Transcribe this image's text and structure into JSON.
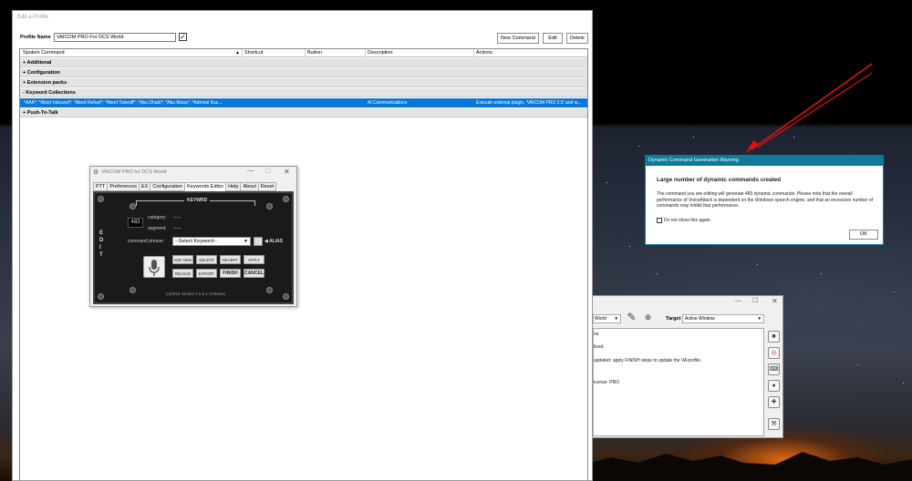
{
  "main_window": {
    "title": "Edit a Profile",
    "profile_label": "Profile Name",
    "profile_name": "VAICOM PRO For DCS World",
    "buttons": {
      "new_command": "New Command",
      "edit": "Edit",
      "delete": "Delete"
    },
    "columns": [
      "Spoken Command",
      "Shortcut",
      "Button",
      "Description",
      "Actions"
    ],
    "groups": [
      "+ Additional",
      "+ Configuration",
      "+ Extension packs",
      "- Keyword Collections"
    ],
    "selected_row": {
      "command": "*AAA*; *Abort Inbound*; *Abort Refuel*; *Abort Takeoff*; *Abu Dhabi*; *Abu Musa*; *Admiral Kuz...",
      "description": "AI Communications",
      "actions": "Execute external plugin, 'VAICOM PRO 2.5' and w..."
    },
    "last_group": "+ Push-To-Talk"
  },
  "vaicom": {
    "title": "VAICOM PRO for DCS World",
    "tabs": [
      "PTT",
      "Preferences",
      "EX",
      "Configuration",
      "Keywords Editor",
      "Help",
      "About",
      "Reset"
    ],
    "keyword_header": "KEYWRD",
    "edit_vertical": "E\nD\nI\nT",
    "count": "483",
    "category_label": "category:",
    "category_value": "-----",
    "segment_label": "segment:",
    "segment_value": "-----",
    "phrase_label": "command phrase:",
    "select_placeholder": "--Select Keyword--",
    "alias_label": "ALIAS",
    "buttons_row1": [
      "ADD NEW",
      "DELETE",
      "REVERT",
      "APPLY"
    ],
    "buttons_row2": [
      "RELOAD",
      "EXPORT",
      "FINISH",
      "CANCEL"
    ],
    "version": "(c)2019 version 2.5.9.1 (release)"
  },
  "warning": {
    "title": "Dynamic Command Generation Warning",
    "heading": "Large number of dynamic commands created",
    "body": "The command you are editing will generate 483 dynamic commands.  Please note that the overall performance of VoiceAttack is dependent on the Windows speech engine, and that an excessive number of commands may inhibit that performance.",
    "checkbox_label": "Do not show this again.",
    "ok": "OK"
  },
  "voiceattack": {
    "profile_partial": "World",
    "target_label": "Target",
    "target_value": "Active Window",
    "log_lines": [
      "ne",
      "lized.",
      "updated: apply FINISH steps to update the VA profile.",
      "icense: PRO"
    ]
  },
  "colors": {
    "selection": "#0a78d7",
    "dialog_accent": "#0e7a9a",
    "arrow": "#e01010"
  }
}
